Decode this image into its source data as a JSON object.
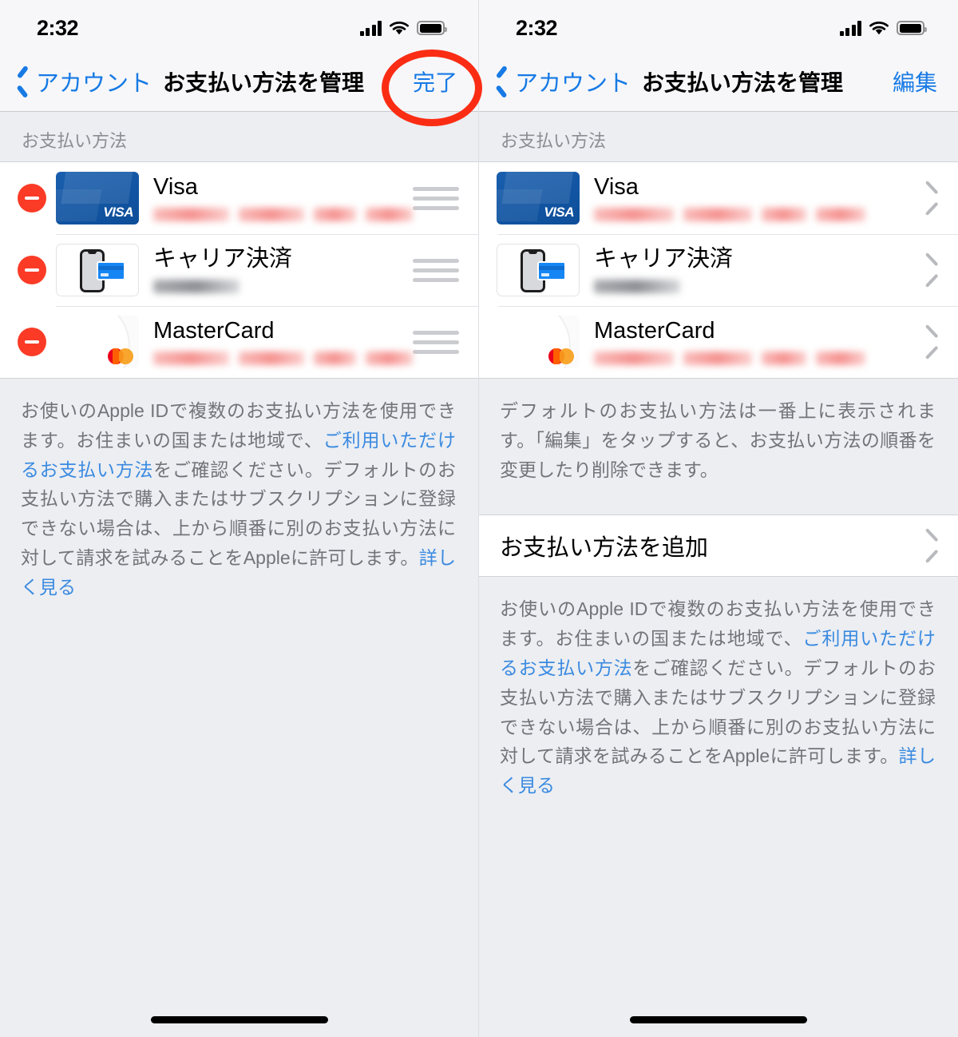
{
  "screens": [
    {
      "id": "edit-mode",
      "statusbar": {
        "time": "2:32",
        "cellular": "signal-bars-icon",
        "wifi": "wifi-icon",
        "battery": "battery-full-icon"
      },
      "navbar": {
        "back_label": "アカウント",
        "title": "お支払い方法を管理",
        "action_label": "完了",
        "annotated": true
      },
      "section_header": "お支払い方法",
      "rows": [
        {
          "title": "Visa",
          "art": "visa",
          "subtitle_redacted": "pink",
          "accessory": "reorder-handle",
          "delete": true
        },
        {
          "title": "キャリア決済",
          "art": "carrier",
          "subtitle_redacted": "gray",
          "accessory": "reorder-handle",
          "delete": true
        },
        {
          "title": "MasterCard",
          "art": "mastercard",
          "subtitle_redacted": "pink",
          "accessory": "reorder-handle",
          "delete": true
        }
      ],
      "note": {
        "part1": "お使いのApple IDで複数のお支払い方法を使用できます。お住まいの国または地域で、",
        "link1": "ご利用いただけるお支払い方法",
        "part2": "をご確認ください。デフォルトのお支払い方法で購入またはサブスクリプションに登録できない場合は、上から順番に別のお支払い方法に対して請求を試みることをAppleに許可します。",
        "link2": "詳しく見る"
      },
      "add_row": null,
      "note2": null
    },
    {
      "id": "view-mode",
      "statusbar": {
        "time": "2:32",
        "cellular": "signal-bars-icon",
        "wifi": "wifi-icon",
        "battery": "battery-full-icon"
      },
      "navbar": {
        "back_label": "アカウント",
        "title": "お支払い方法を管理",
        "action_label": "編集",
        "annotated": false
      },
      "section_header": "お支払い方法",
      "rows": [
        {
          "title": "Visa",
          "art": "visa",
          "subtitle_redacted": "pink",
          "accessory": "chevron-right-icon",
          "delete": false
        },
        {
          "title": "キャリア決済",
          "art": "carrier",
          "subtitle_redacted": "gray",
          "accessory": "chevron-right-icon",
          "delete": false
        },
        {
          "title": "MasterCard",
          "art": "mastercard",
          "subtitle_redacted": "pink",
          "accessory": "chevron-right-icon",
          "delete": false
        }
      ],
      "note": {
        "part1": "デフォルトのお支払い方法は一番上に表示されます。「編集」をタップすると、お支払い方法の順番を変更したり削除できます。",
        "link1": "",
        "part2": "",
        "link2": ""
      },
      "add_row": {
        "label": "お支払い方法を追加",
        "accessory": "chevron-right-icon"
      },
      "note2": {
        "part1": "お使いのApple IDで複数のお支払い方法を使用できます。お住まいの国または地域で、",
        "link1": "ご利用いただけるお支払い方法",
        "part2": "をご確認ください。デフォルトのお支払い方法で購入またはサブスクリプションに登録できない場合は、上から順番に別のお支払い方法に対して請求を試みることをAppleに許可します。",
        "link2": "詳しく見る"
      }
    }
  ],
  "colors": {
    "tint": "#177ae5",
    "annotation": "#fa2d14",
    "delete": "#fb3b26",
    "background": "#eceef2",
    "bar": "#f7f7f9"
  },
  "home_indicator": "home-indicator"
}
